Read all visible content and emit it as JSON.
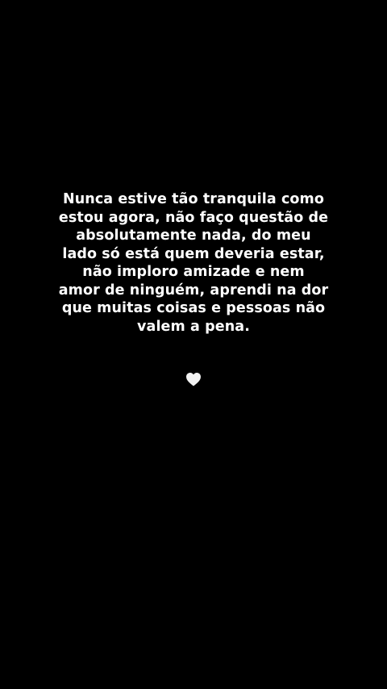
{
  "quote": {
    "lines": [
      "Nunca estive tão tranquila como",
      "estou agora, não faço questão de",
      "absolutamente nada, do meu",
      "lado só está quem deveria estar,",
      "não imploro amizade e nem",
      "amor de ninguém, aprendi na dor",
      "que muitas coisas e pessoas não",
      "valem a pena."
    ]
  },
  "heart": {
    "icon": "white-heart-icon",
    "color": "#f2f2f2"
  },
  "colors": {
    "background": "#000000",
    "text": "#ffffff"
  }
}
